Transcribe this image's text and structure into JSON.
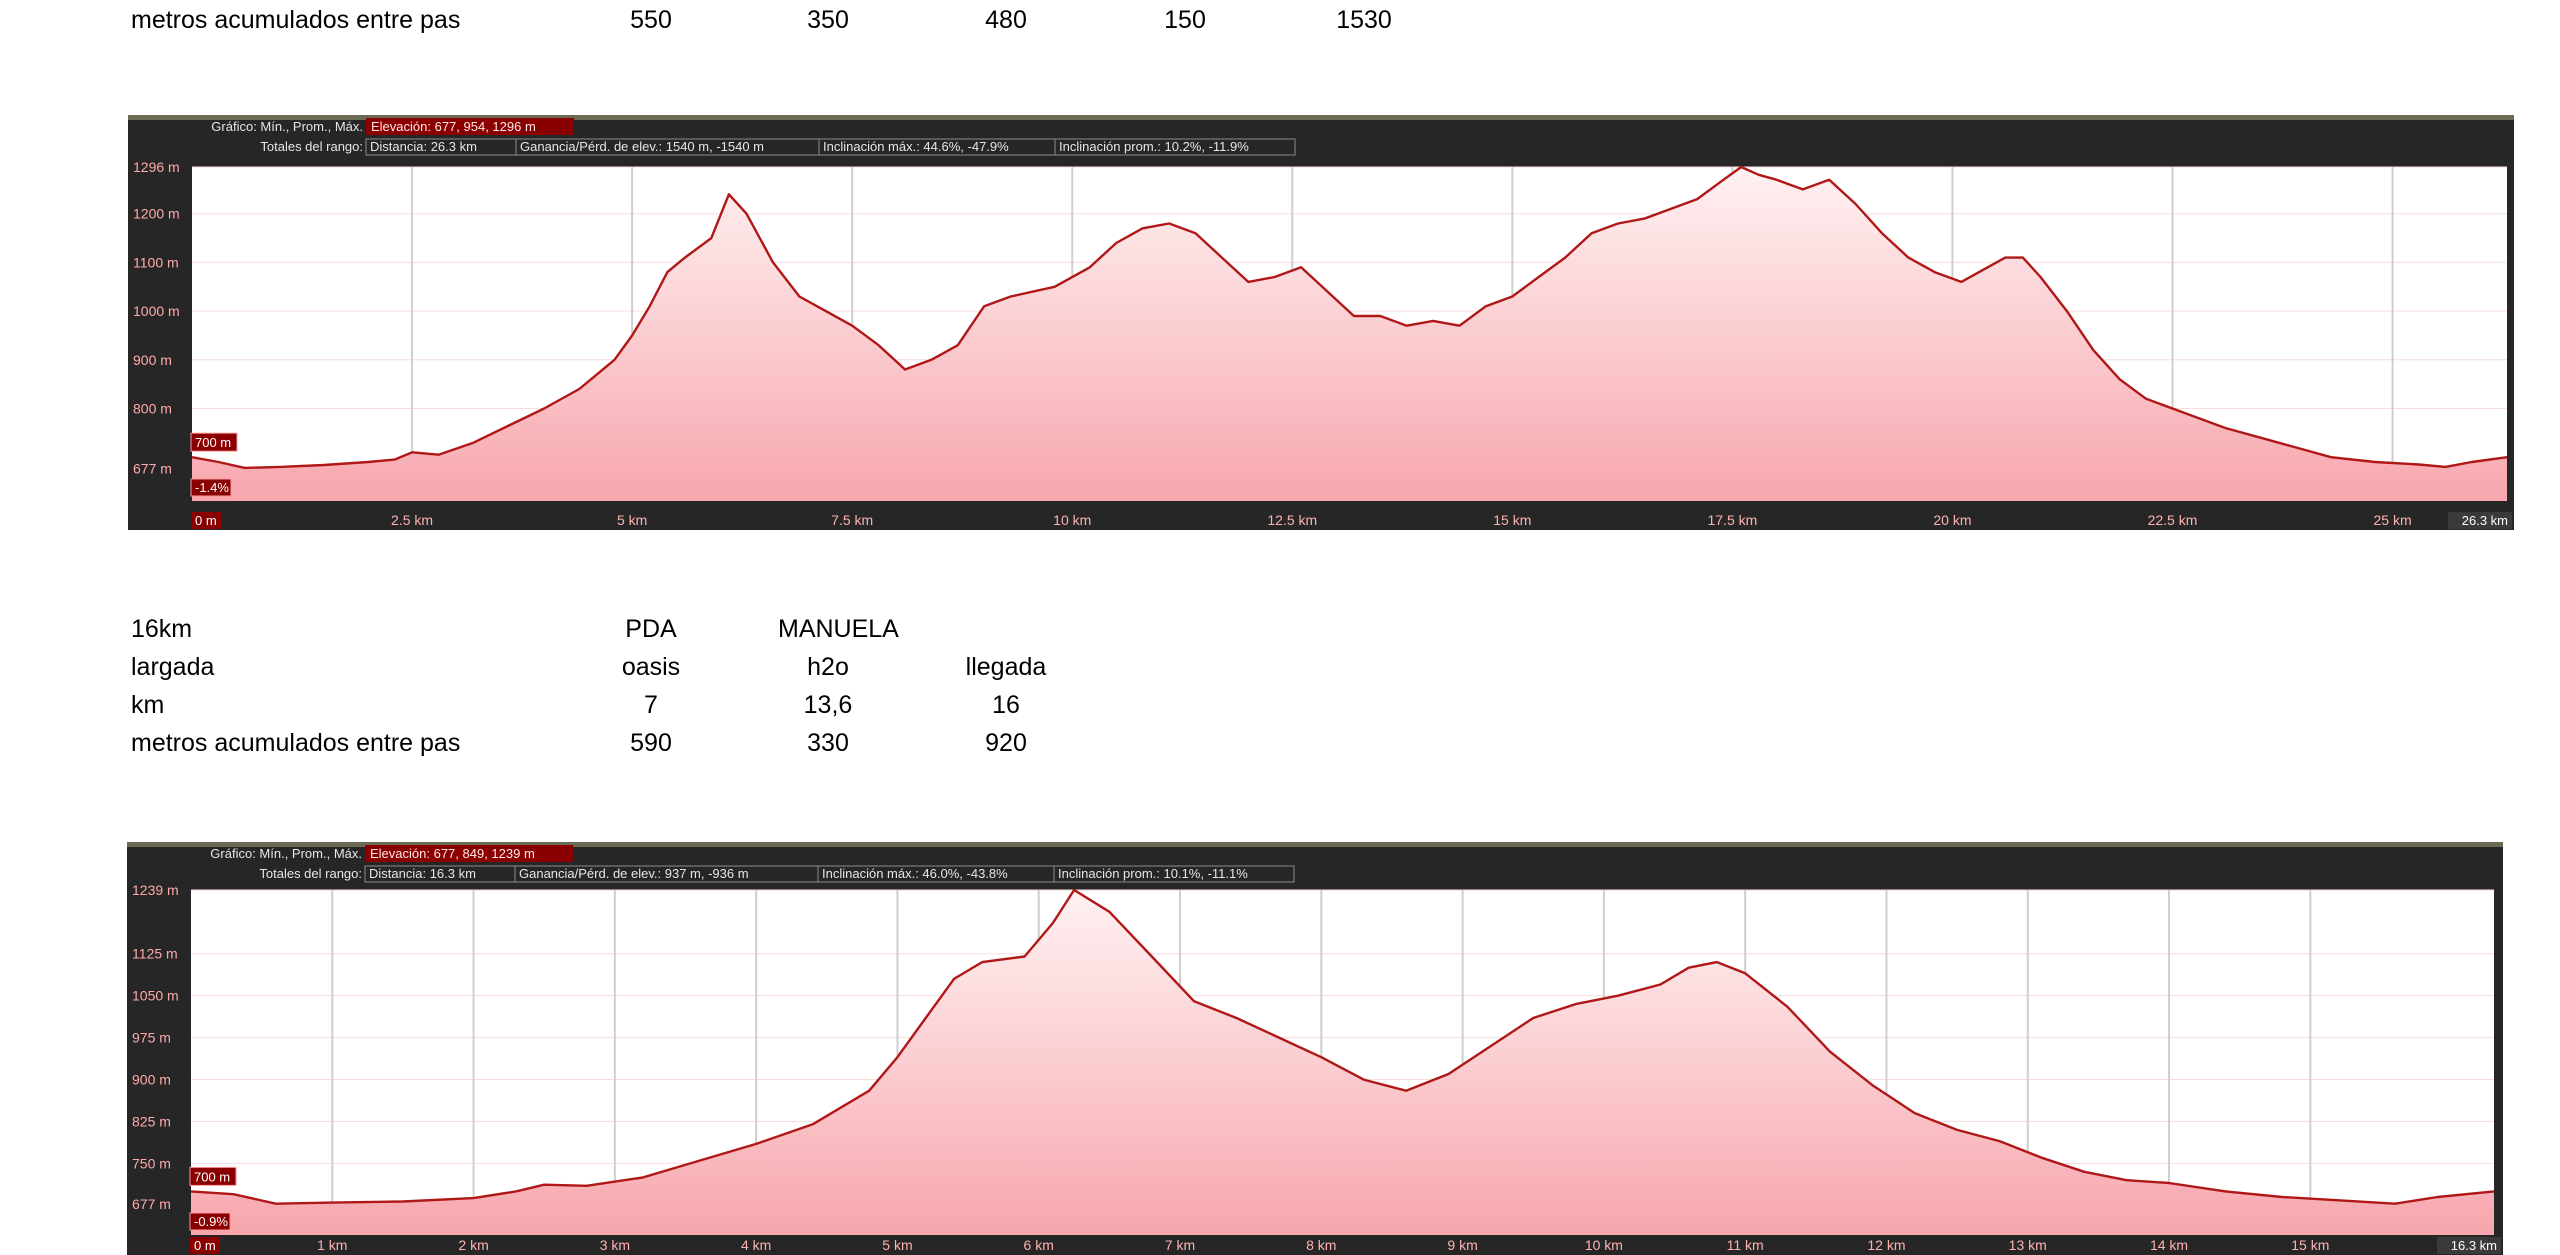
{
  "colors": {
    "frame": "#262626",
    "tag_bg": "#8a0000",
    "line": "#b01818",
    "fill_top": "#fbd1d4",
    "fill_bottom": "#f7a6ad",
    "axis_text_left": "#ffaaaa",
    "axis_text_bottom": "#ffb2b2"
  },
  "table1": {
    "rows": [
      {
        "label": "metros acumulados entre pas",
        "values": [
          "550",
          "350",
          "480",
          "150",
          "1530"
        ]
      }
    ]
  },
  "table2": {
    "rows": [
      {
        "label": "16km",
        "values": [
          "PDA",
          "MANUELA",
          "",
          ""
        ]
      },
      {
        "label": "largada",
        "values": [
          "oasis",
          "h2o",
          "llegada",
          ""
        ]
      },
      {
        "label": "km",
        "values": [
          "7",
          "13,6",
          "16",
          ""
        ]
      },
      {
        "label": "metros acumulados entre pas",
        "values": [
          "590",
          "330",
          "920",
          ""
        ]
      }
    ]
  },
  "chart_data": [
    {
      "type": "area",
      "header": {
        "graph_label": "Gráfico: Mín., Prom., Máx.",
        "elevation": "Elevación: 677, 954, 1296 m",
        "totals_label": "Totales del rango:",
        "distance": "Distancia: 26.3 km",
        "gain": "Ganancia/Pérd. de elev.: 1540 m, -1540 m",
        "max_slope": "Inclinación máx.: 44.6%, -47.9%",
        "avg_slope": "Inclinación prom.: 10.2%, -11.9%"
      },
      "y_ticks": [
        677,
        800,
        900,
        1000,
        1100,
        1200,
        1296
      ],
      "y_tick_labels": [
        "677 m",
        "800 m",
        "900 m",
        "1000 m",
        "1100 m",
        "1200 m",
        "1296 m"
      ],
      "x_ticks": [
        2.5,
        5,
        7.5,
        10,
        12.5,
        15,
        17.5,
        20,
        22.5,
        25
      ],
      "x_tick_labels": [
        "2.5 km",
        "5 km",
        "7.5 km",
        "10 km",
        "12.5 km",
        "15 km",
        "17.5 km",
        "20 km",
        "22.5 km",
        "25 km"
      ],
      "x_start_label": "0 m",
      "x_end_label": "26.3 km",
      "cursor_elev_label": "700 m",
      "cursor_slope_label": "-1.4%",
      "xlim": [
        0,
        26.3
      ],
      "ylim": [
        610,
        1296
      ],
      "x": [
        0,
        0.3,
        0.6,
        1.0,
        1.5,
        2.0,
        2.3,
        2.5,
        2.8,
        3.2,
        3.6,
        4.0,
        4.4,
        4.8,
        5.0,
        5.2,
        5.4,
        5.6,
        5.9,
        6.1,
        6.3,
        6.6,
        6.9,
        7.2,
        7.5,
        7.8,
        8.1,
        8.4,
        8.7,
        9.0,
        9.3,
        9.8,
        10.2,
        10.5,
        10.8,
        11.1,
        11.4,
        11.7,
        12.0,
        12.3,
        12.6,
        12.9,
        13.2,
        13.5,
        13.8,
        14.1,
        14.4,
        14.7,
        15.0,
        15.3,
        15.6,
        15.9,
        16.2,
        16.5,
        16.8,
        17.1,
        17.4,
        17.6,
        17.8,
        18.0,
        18.3,
        18.6,
        18.9,
        19.2,
        19.5,
        19.8,
        20.1,
        20.4,
        20.6,
        20.8,
        21.0,
        21.3,
        21.6,
        21.9,
        22.2,
        22.5,
        22.8,
        23.1,
        23.5,
        23.9,
        24.3,
        24.8,
        25.3,
        25.6,
        25.9,
        26.3
      ],
      "y": [
        700,
        690,
        678,
        680,
        684,
        690,
        695,
        710,
        705,
        730,
        765,
        800,
        840,
        900,
        950,
        1010,
        1080,
        1110,
        1150,
        1240,
        1200,
        1100,
        1030,
        1000,
        970,
        930,
        880,
        900,
        930,
        1010,
        1030,
        1050,
        1090,
        1140,
        1170,
        1180,
        1160,
        1110,
        1060,
        1070,
        1090,
        1040,
        990,
        990,
        970,
        980,
        970,
        1010,
        1030,
        1070,
        1110,
        1160,
        1180,
        1190,
        1210,
        1230,
        1270,
        1296,
        1280,
        1270,
        1250,
        1270,
        1220,
        1160,
        1110,
        1080,
        1060,
        1090,
        1110,
        1110,
        1070,
        1000,
        920,
        860,
        820,
        800,
        780,
        760,
        740,
        720,
        700,
        690,
        685,
        680,
        690,
        700
      ]
    },
    {
      "type": "area",
      "header": {
        "graph_label": "Gráfico: Mín., Prom., Máx.",
        "elevation": "Elevación: 677, 849, 1239 m",
        "totals_label": "Totales del rango:",
        "distance": "Distancia: 16.3 km",
        "gain": "Ganancia/Pérd. de elev.: 937 m, -936 m",
        "max_slope": "Inclinación máx.: 46.0%, -43.8%",
        "avg_slope": "Inclinación prom.: 10.1%, -11.1%"
      },
      "y_ticks": [
        677,
        750,
        825,
        900,
        975,
        1050,
        1125,
        1239
      ],
      "y_tick_labels": [
        "677 m",
        "750 m",
        "825 m",
        "900 m",
        "975 m",
        "1050 m",
        "1125 m",
        "1239 m"
      ],
      "x_ticks": [
        1,
        2,
        3,
        4,
        5,
        6,
        7,
        8,
        9,
        10,
        11,
        12,
        13,
        14,
        15
      ],
      "x_tick_labels": [
        "1 km",
        "2 km",
        "3 km",
        "4 km",
        "5 km",
        "6 km",
        "7 km",
        "8 km",
        "9 km",
        "10 km",
        "11 km",
        "12 km",
        "13 km",
        "14 km",
        "15 km"
      ],
      "x_start_label": "0 m",
      "x_end_label": "16.3 km",
      "cursor_elev_label": "700 m",
      "cursor_slope_label": "-0.9%",
      "xlim": [
        0,
        16.3
      ],
      "ylim": [
        622,
        1239
      ],
      "x": [
        0,
        0.3,
        0.6,
        1.0,
        1.5,
        2.0,
        2.3,
        2.5,
        2.8,
        3.2,
        3.6,
        4.0,
        4.4,
        4.8,
        5.0,
        5.2,
        5.4,
        5.6,
        5.9,
        6.1,
        6.25,
        6.5,
        6.8,
        7.1,
        7.4,
        7.7,
        8.0,
        8.3,
        8.6,
        8.9,
        9.2,
        9.5,
        9.8,
        10.1,
        10.4,
        10.6,
        10.8,
        11.0,
        11.3,
        11.6,
        11.9,
        12.2,
        12.5,
        12.8,
        13.1,
        13.4,
        13.7,
        14.0,
        14.4,
        14.8,
        15.2,
        15.6,
        15.9,
        16.3
      ],
      "y": [
        700,
        695,
        678,
        680,
        682,
        688,
        700,
        712,
        710,
        725,
        755,
        785,
        820,
        880,
        940,
        1010,
        1080,
        1110,
        1120,
        1180,
        1239,
        1200,
        1120,
        1040,
        1010,
        975,
        940,
        900,
        880,
        910,
        960,
        1010,
        1035,
        1050,
        1070,
        1100,
        1110,
        1090,
        1030,
        950,
        890,
        840,
        810,
        790,
        760,
        735,
        720,
        715,
        700,
        690,
        684,
        678,
        690,
        700
      ]
    }
  ]
}
